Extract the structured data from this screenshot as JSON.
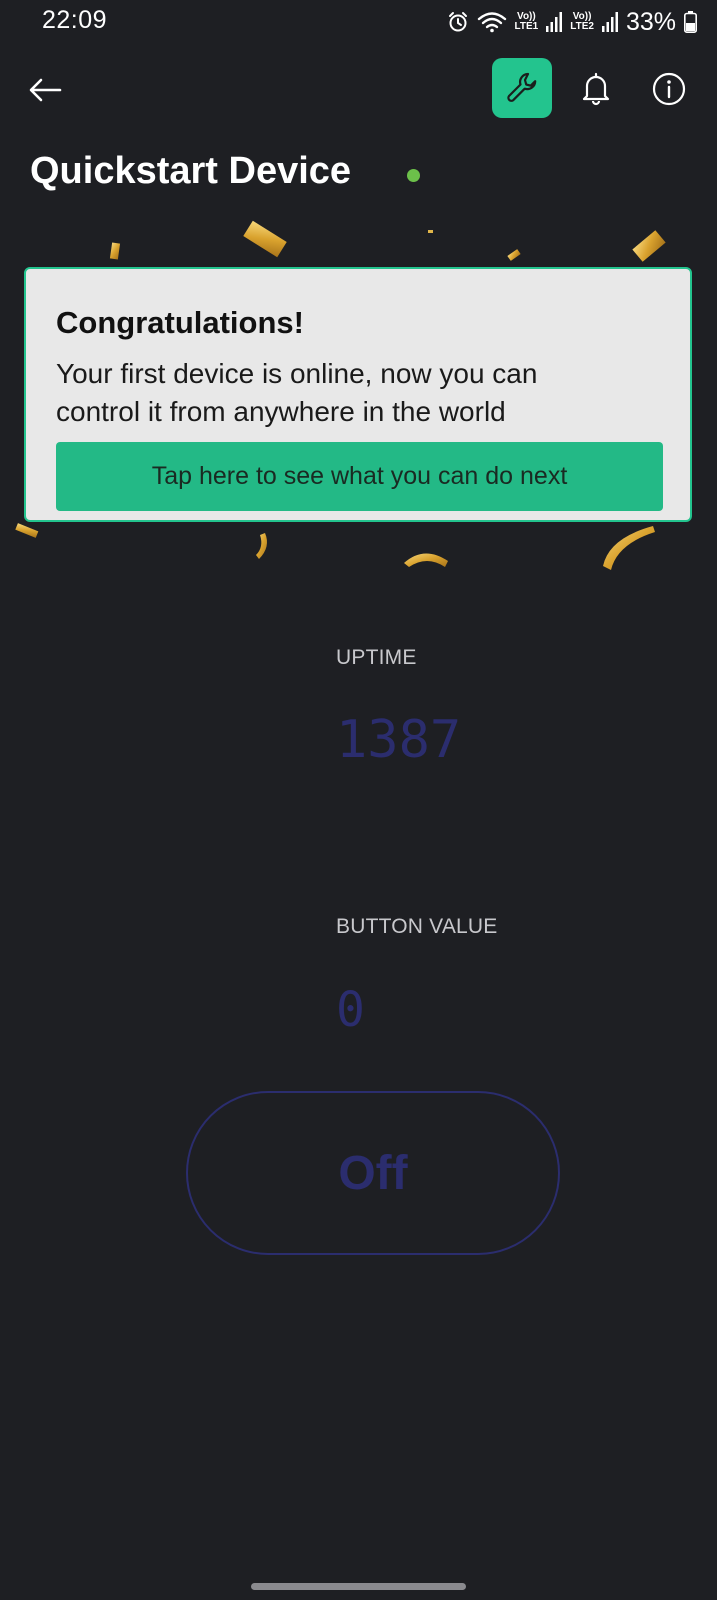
{
  "status_bar": {
    "time": "22:09",
    "battery": "33%",
    "sim1_label_top": "Vo))",
    "sim1_label_bottom": "LTE1",
    "sim2_label_top": "Vo))",
    "sim2_label_bottom": "LTE2",
    "icons": [
      "alarm-icon",
      "wifi-icon",
      "signal-icon",
      "signal-icon",
      "battery-icon"
    ]
  },
  "app_bar": {
    "back_icon": "arrow-left-icon",
    "actions": [
      "wrench-icon",
      "bell-icon",
      "info-icon"
    ],
    "accent_color": "#23c48e"
  },
  "device": {
    "title": "Quickstart Device",
    "status": "online",
    "status_color": "#6cc04a"
  },
  "congrats": {
    "heading": "Congratulations!",
    "message": "Your first device is online, now you can control it from anywhere in the world",
    "button_label": "Tap here to see what you can do next"
  },
  "widgets": {
    "uptime": {
      "label": "UPTIME",
      "value": "1387"
    },
    "button_value": {
      "label": "BUTTON VALUE",
      "value": "0"
    },
    "switch": {
      "label": "Off",
      "state": "off"
    }
  }
}
